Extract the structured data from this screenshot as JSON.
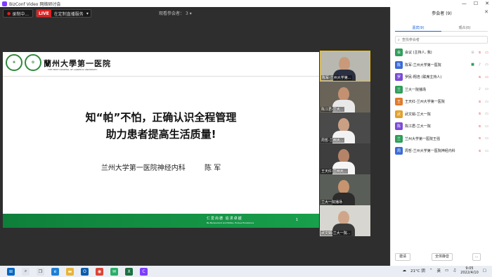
{
  "titlebar": {
    "app_title": "BizConf Video 网络研讨会",
    "min": "—",
    "max": "☐",
    "close": "✕"
  },
  "topbar": {
    "record_label": "录制中...",
    "live_tag": "LIVE",
    "live_text": "在定制直播服务",
    "viewer_count_label": "观看参会者：",
    "viewer_count": "3"
  },
  "slide": {
    "hospital_name": "蘭州大學第一医院",
    "hospital_en": "THE FIRST HOSPITAL OF LANZHOU UNIVERSITY",
    "title_line1": "知“帕”不怕，正确认识全程管理",
    "title_line2": "助力患者提高生活质量!",
    "dept": "兰州大学第一医院神经内科",
    "speaker": "陈 军",
    "motto": "仁爱尚德 追求卓越",
    "motto_en": "Be Benevolent and Noble, Pursue Excellence",
    "page": "1"
  },
  "videos": [
    {
      "name": "陈军-兰州大学第..."
    },
    {
      "name": "陈江君-兰大..."
    },
    {
      "name": "周哲-兰州大..."
    },
    {
      "name": "王天红-兰州大..."
    },
    {
      "name": "兰大一院播场"
    },
    {
      "name": "武文娟-兰大一院..."
    }
  ],
  "sidebar": {
    "title": "参会者 (9)",
    "close": "✕",
    "tabs": [
      {
        "label": "嘉宾(9)"
      },
      {
        "label": "观众(0)"
      }
    ],
    "search_placeholder": "查找参会者",
    "participants": [
      {
        "avatar": "会",
        "name": "会议 (主持人, 我)",
        "color": "#2f9e5a"
      },
      {
        "avatar": "陈",
        "name": "陈军-兰州大学第一医院",
        "color": "#3b6bd6"
      },
      {
        "avatar": "罗",
        "name": "罗民-翔浩 (联席主持人)",
        "color": "#7b4bd6"
      },
      {
        "avatar": "兰",
        "name": "兰大一院播场",
        "color": "#2f9e5a"
      },
      {
        "avatar": "王",
        "name": "王天红-兰州大学第一医院",
        "color": "#e07a2b"
      },
      {
        "avatar": "武",
        "name": "武文娟-兰大一院",
        "color": "#e0a12b"
      },
      {
        "avatar": "陈",
        "name": "陈江君-兰大一院",
        "color": "#7b4bd6"
      },
      {
        "avatar": "兰",
        "name": "兰州大学第一医院王强",
        "color": "#2f9e5a"
      },
      {
        "avatar": "周",
        "name": "周哲-兰州大学第一医院神经内科",
        "color": "#3b6bd6"
      }
    ],
    "invite_label": "邀请",
    "mute_all_label": "全体静音",
    "more_label": "..."
  },
  "taskbar": {
    "weather": "21°C 阴",
    "lang": "英",
    "time": "9:05",
    "date": "2022/4/10"
  }
}
